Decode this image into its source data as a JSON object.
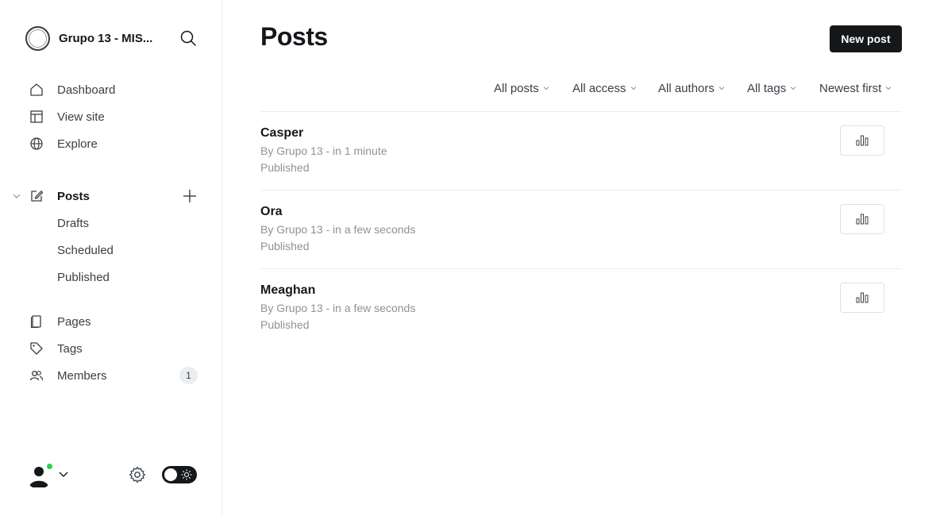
{
  "sidebar": {
    "site_title": "Grupo 13 - MIS...",
    "nav": {
      "dashboard": "Dashboard",
      "view_site": "View site",
      "explore": "Explore",
      "posts": "Posts",
      "drafts": "Drafts",
      "scheduled": "Scheduled",
      "published": "Published",
      "pages": "Pages",
      "tags": "Tags",
      "members": "Members",
      "members_count": "1"
    },
    "icons": {
      "search": "search-icon",
      "add": "plus-icon",
      "settings": "gear-icon",
      "theme": "sun-icon"
    }
  },
  "main": {
    "title": "Posts",
    "new_post_label": "New post",
    "filters": [
      "All posts",
      "All access",
      "All authors",
      "All tags",
      "Newest first"
    ],
    "posts": [
      {
        "title": "Casper",
        "meta": "By Grupo 13 - in 1 minute",
        "status": "Published"
      },
      {
        "title": "Ora",
        "meta": "By Grupo 13 - in a few seconds",
        "status": "Published"
      },
      {
        "title": "Meaghan",
        "meta": "By Grupo 13 - in a few seconds",
        "status": "Published"
      }
    ]
  },
  "colors": {
    "primary": "#15171a",
    "muted_text": "#8e9297",
    "online": "#30cf43",
    "divider": "#ebeef0"
  }
}
